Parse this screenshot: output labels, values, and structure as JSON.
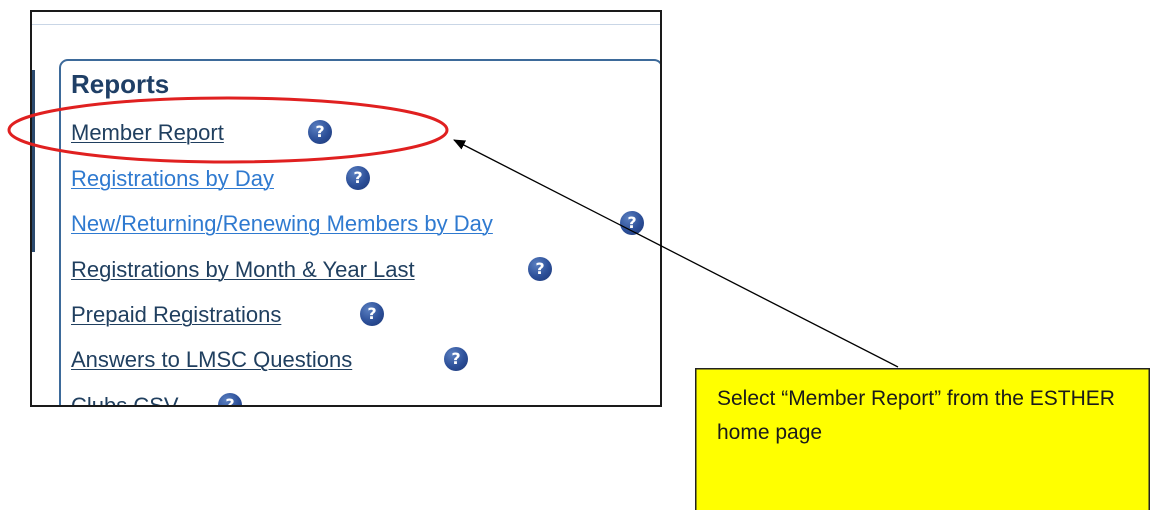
{
  "panel": {
    "title": "Reports",
    "links": [
      {
        "label": "Member Report",
        "help": "?"
      },
      {
        "label": "Registrations by Day",
        "help": "?"
      },
      {
        "label": "New/Returning/Renewing Members by Day",
        "help": "?"
      },
      {
        "label": "Registrations by Month & Year Last",
        "help": "?"
      },
      {
        "label": "Prepaid Registrations",
        "help": "?"
      },
      {
        "label": "Answers to LMSC Questions",
        "help": "?"
      },
      {
        "label": "Clubs CSV",
        "help": "?"
      }
    ]
  },
  "callout": {
    "text": "Select “Member Report” from the ESTHER home page"
  },
  "colors": {
    "highlight_ellipse": "#e02020",
    "callout_fill": "#ffff00",
    "link_dark": "#203f5f",
    "link_light": "#2f7ad0",
    "help_icon": "#2c4f98"
  },
  "icons": {
    "help": "question-circle-icon",
    "arrow": "arrow-pointer"
  }
}
